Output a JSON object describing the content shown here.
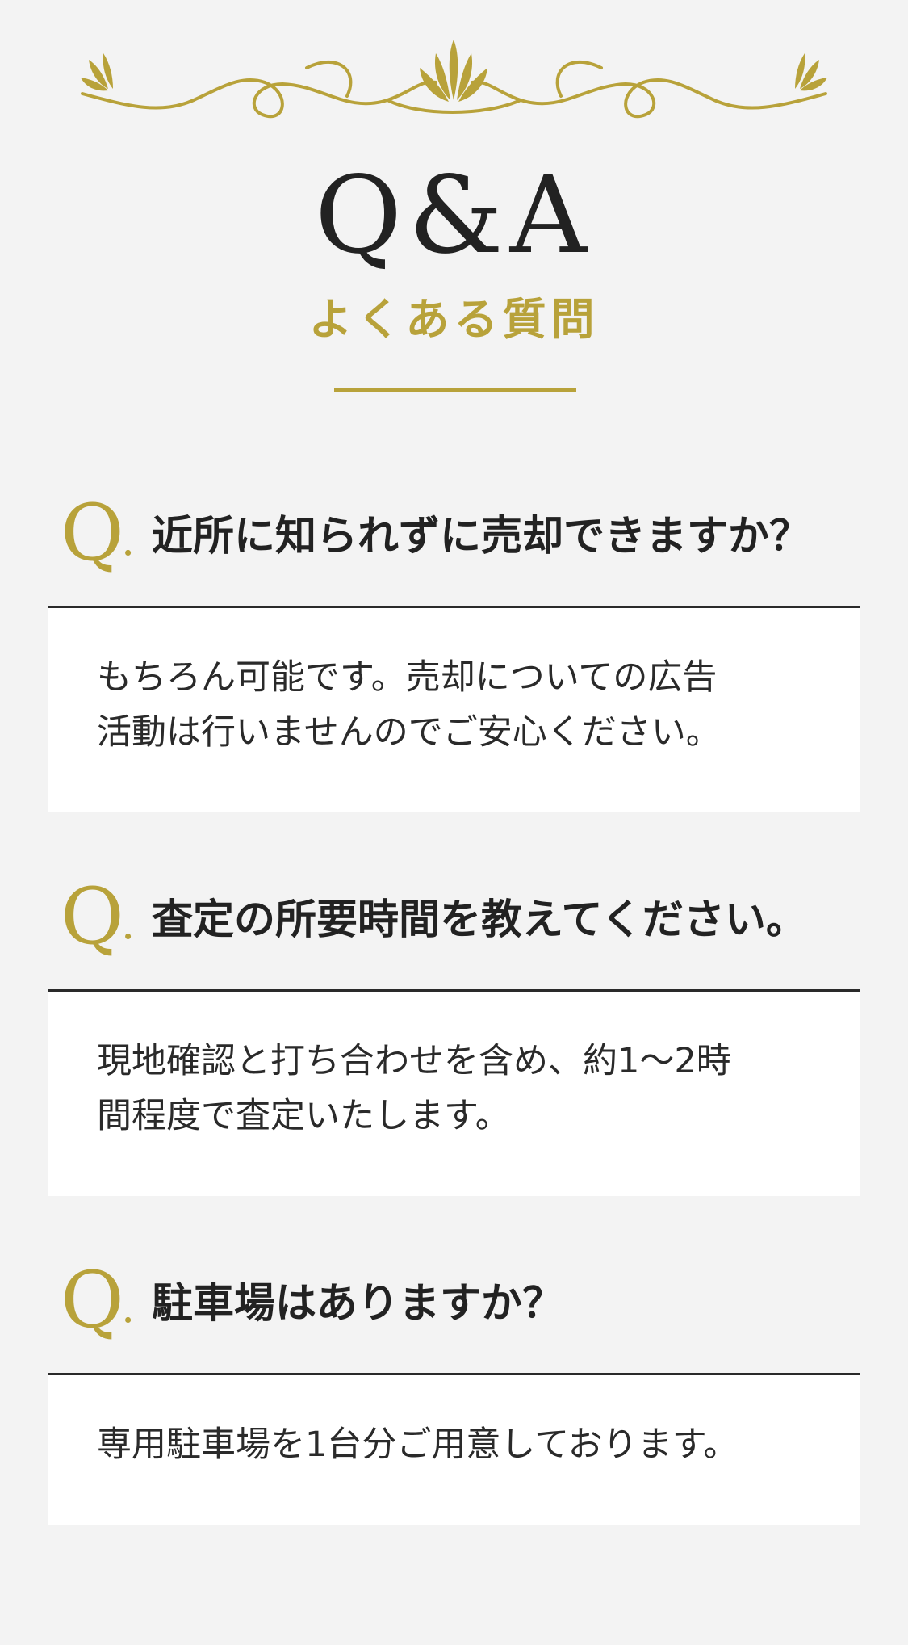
{
  "colors": {
    "accent": "#b8a23a",
    "background": "#f3f3f3",
    "text": "#2a2a2a",
    "card": "#ffffff"
  },
  "header": {
    "title": "Q&A",
    "subtitle": "よくある質問",
    "ornament_icon": "flourish-ornament"
  },
  "faq": [
    {
      "q_mark": "Q",
      "q_dot": ".",
      "question": "近所に知られずに売却できますか？",
      "answer": "もちろん可能です。売却についての広告\n活動は行いませんのでご安心ください。"
    },
    {
      "q_mark": "Q",
      "q_dot": ".",
      "question": "査定の所要時間を教えてください。",
      "answer": "現地確認と打ち合わせを含め、約1～2時\n間程度で査定いたします。"
    },
    {
      "q_mark": "Q",
      "q_dot": ".",
      "question": "駐車場はありますか？",
      "answer": "専用駐車場を1台分ご用意しております。"
    }
  ]
}
